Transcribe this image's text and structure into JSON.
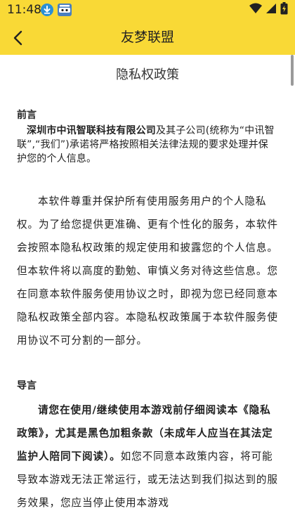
{
  "status_bar": {
    "time": "11:48",
    "icons": [
      "download-notification-icon",
      "app-notification-icon",
      "wifi-icon",
      "signal-icon",
      "battery-charging-icon"
    ]
  },
  "app_bar": {
    "title": "友梦联盟",
    "back_icon": "back-arrow-icon",
    "background": "#F9D936"
  },
  "document": {
    "title": "隐私权政策",
    "preface": {
      "heading": "前言",
      "company_name": "深圳市中讯智联科技有限公司",
      "text": "及其子公司(统称为“中讯智联”,“我们”)承诺将严格按照相关法律法规的要求处理并保护您的个人信息。"
    },
    "intro_paragraph": "本软件尊重并保护所有使用服务用户的个人隐私权。为了给您提供更准确、更有个性化的服务，本软件会按照本隐私权政策的规定使用和披露您的个人信息。但本软件将以高度的勤勉、审慎义务对待这些信息。您在同意本软件服务使用协议之时，即视为您已经同意本隐私权政策全部内容。本隐私权政策属于本软件服务使用协议不可分割的一部分。",
    "guide": {
      "heading": "导言",
      "bold_text": "请您在使用/继续使用本游戏前仔细阅读本《隐私政策》，尤其是黑色加粗条款（未成年人应当在其法定监护人陪同下阅读）。",
      "text": "如您不同意本政策内容，将可能导致本游戏无法正常运行，或无法达到我们拟达到的服务效果，您应当停止使用本游戏"
    }
  }
}
